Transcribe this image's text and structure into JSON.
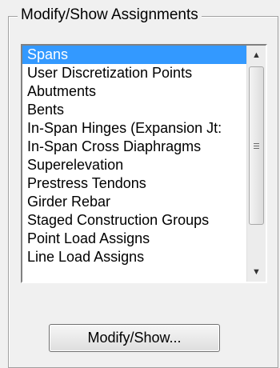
{
  "group": {
    "title": "Modify/Show Assignments"
  },
  "list": {
    "items": [
      "Spans",
      "User Discretization Points",
      "Abutments",
      "Bents",
      "In-Span Hinges (Expansion Jt:",
      "In-Span Cross Diaphragms",
      "Superelevation",
      "Prestress Tendons",
      "Girder Rebar",
      "Staged Construction Groups",
      "Point Load Assigns",
      "Line Load Assigns"
    ],
    "selected_index": 0,
    "colors": {
      "selection_background": "#3399ff",
      "selection_text": "#ffffff"
    }
  },
  "scrollbar": {
    "up_arrow_icon": "triangle-up",
    "down_arrow_icon": "triangle-down",
    "thumb_grip_icon": "grip-lines"
  },
  "button": {
    "label": "Modify/Show..."
  }
}
